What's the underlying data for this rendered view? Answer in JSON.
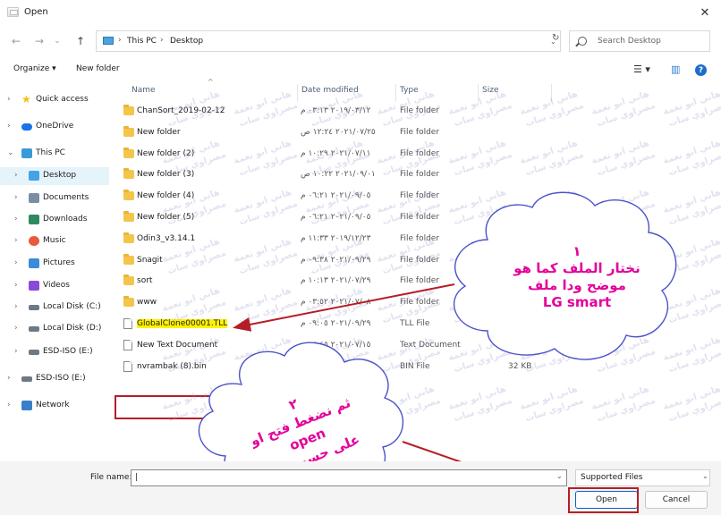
{
  "window": {
    "title": "Open"
  },
  "nav": {
    "path": [
      "This PC",
      "Desktop"
    ],
    "search_placeholder": "Search Desktop",
    "back_glyph": "←",
    "forward_glyph": "→",
    "recent_glyph": "⌄",
    "up_glyph": "↑",
    "separator_glyph": "›",
    "dropdown_glyph": "⌄",
    "refresh_glyph": "↻"
  },
  "toolbar": {
    "organize_label": "Organize ▾",
    "new_folder_label": "New folder",
    "view_glyph": "☰ ▾",
    "pane_glyph": "▥",
    "help_glyph": "?"
  },
  "sidebar": {
    "items": [
      {
        "label": "Quick access",
        "chevron": "›",
        "icon": "star-icon",
        "color": "#f2c40f"
      },
      {
        "label": "OneDrive",
        "chevron": "›",
        "icon": "cloud-icon",
        "color": "#1a73e8"
      },
      {
        "label": "This PC",
        "chevron": "⌄",
        "icon": "pc-icon",
        "color": "#3a9ad9"
      },
      {
        "label": "Desktop",
        "chevron": "›",
        "icon": "desktop-icon",
        "color": "#43a3e6"
      },
      {
        "label": "Documents",
        "chevron": "›",
        "icon": "documents-icon",
        "color": "#7a8ea3"
      },
      {
        "label": "Downloads",
        "chevron": "›",
        "icon": "download-icon",
        "color": "#2f8a5f"
      },
      {
        "label": "Music",
        "chevron": "›",
        "icon": "music-icon",
        "color": "#e85b3a"
      },
      {
        "label": "Pictures",
        "chevron": "›",
        "icon": "pictures-icon",
        "color": "#3a8bd9"
      },
      {
        "label": "Videos",
        "chevron": "›",
        "icon": "videos-icon",
        "color": "#8a4ad9"
      },
      {
        "label": "Local Disk (C:)",
        "chevron": "›",
        "icon": "drive-icon",
        "color": "#6d7a86"
      },
      {
        "label": "Local Disk (D:)",
        "chevron": "›",
        "icon": "drive-icon",
        "color": "#6d7a86"
      },
      {
        "label": "ESD-ISO (E:)",
        "chevron": "›",
        "icon": "drive-icon",
        "color": "#6d7a86"
      },
      {
        "label": "ESD-ISO (E:)",
        "chevron": "›",
        "icon": "drive-icon",
        "color": "#6d7a86"
      },
      {
        "label": "Network",
        "chevron": "›",
        "icon": "network-icon",
        "color": "#3a7fc9"
      }
    ]
  },
  "columns": {
    "name": "Name",
    "date": "Date modified",
    "type": "Type",
    "size": "Size",
    "sort_glyph": "^"
  },
  "files": [
    {
      "name": "ChanSort_2019-02-12",
      "date": "٢٠١٩/٠٣/١٢ ٠٣:١٣ م",
      "type": "File folder",
      "size": "",
      "kind": "folder"
    },
    {
      "name": "New folder",
      "date": "٢٠٢١/٠٧/٢٥ ١٢:٢٤ ص",
      "type": "File folder",
      "size": "",
      "kind": "folder"
    },
    {
      "name": "New folder (2)",
      "date": "٢٠٢١/٠٧/١١ ١٠:٢٩ م",
      "type": "File folder",
      "size": "",
      "kind": "folder"
    },
    {
      "name": "New folder (3)",
      "date": "٢٠٢١/٠٩/٠١ ١٠:٢٢ ص",
      "type": "File folder",
      "size": "",
      "kind": "folder"
    },
    {
      "name": "New folder (4)",
      "date": "٢٠٢١/٠٩/٠٥ ٠٦:٢١ م",
      "type": "File folder",
      "size": "",
      "kind": "folder"
    },
    {
      "name": "New folder (5)",
      "date": "٢٠٢١/٠٩/٠٥ ٠٦:٢١ م",
      "type": "File folder",
      "size": "",
      "kind": "folder"
    },
    {
      "name": "Odin3_v3.14.1",
      "date": "٢٠١٩/١٢/٢٣ ١١:٣٣ م",
      "type": "File folder",
      "size": "",
      "kind": "folder"
    },
    {
      "name": "Snagit",
      "date": "٢٠٢١/٠٩/٢٩ ٠٩:٣٨ م",
      "type": "File folder",
      "size": "",
      "kind": "folder"
    },
    {
      "name": "sort",
      "date": "٢٠٢١/٠٧/٢٩ ١٠:١٣ م",
      "type": "File folder",
      "size": "",
      "kind": "folder"
    },
    {
      "name": "www",
      "date": "٢٠٢١/٠٧/٠٨ ٠٣:٥٢ م",
      "type": "File folder",
      "size": "",
      "kind": "folder"
    },
    {
      "name": "GlobalClone00001.TLL",
      "date": "٢٠٢١/٠٩/٢٩ ٠٩:٠٥ م",
      "type": "TLL File",
      "size": "",
      "kind": "file",
      "highlight": true
    },
    {
      "name": "New Text Document",
      "date": "٢٠٢١/٠٧/١٥ ٠٤:٤٥ م",
      "type": "Text Document",
      "size": "",
      "kind": "file"
    },
    {
      "name": "nvrambak (8).bin",
      "date": "٢٠٢١/٠٩/٢٩ ٠٩:٣٩ م",
      "type": "BIN File",
      "size": "32 KB",
      "kind": "file"
    }
  ],
  "footer": {
    "file_name_label": "File name:",
    "file_name_value": "|",
    "filter_value": "Supported Files",
    "open_label": "Open",
    "cancel_label": "Cancel",
    "dropdown_glyph": "⌄"
  },
  "annotations": {
    "cloud1_lines": [
      "١",
      "نختار الملف كما هو",
      "موضح ودا ملف",
      "LG smart"
    ],
    "cloud2_lines": [
      "٢",
      "ثم نضغط فتح او",
      "open",
      "على حسب لغة"
    ],
    "watermark_lines": [
      "هاني ابو نعمة",
      "مصراوي سات"
    ],
    "accent_color": "#b71d26",
    "cloud_text_color": "#e4009b",
    "cloud_border_color": "#4a52c8"
  }
}
